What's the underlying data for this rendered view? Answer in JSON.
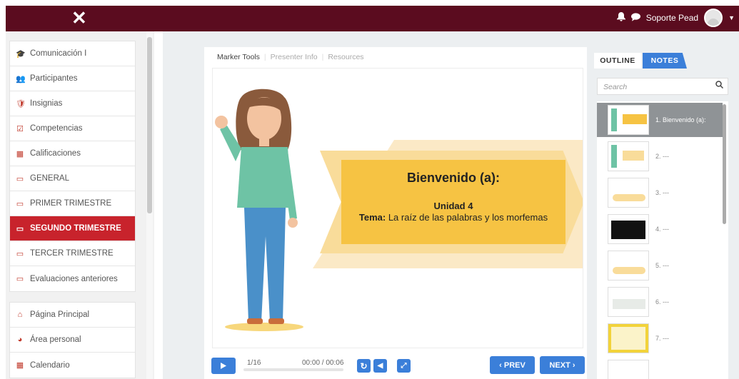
{
  "header": {
    "close_label": "✕",
    "user_name": "Soporte Pead",
    "icons": [
      "bell-icon",
      "chat-icon",
      "caret-down-icon"
    ]
  },
  "sidebar": {
    "course_items": [
      {
        "label": "Comunicación I",
        "icon": "graduation-cap-icon",
        "glyph": "🎓"
      },
      {
        "label": "Participantes",
        "icon": "users-icon",
        "glyph": "👥"
      },
      {
        "label": "Insignias",
        "icon": "shield-icon",
        "glyph": "🛡"
      },
      {
        "label": "Competencias",
        "icon": "check-square-icon",
        "glyph": "☑"
      },
      {
        "label": "Calificaciones",
        "icon": "table-icon",
        "glyph": "▦"
      },
      {
        "label": "GENERAL",
        "icon": "folder-icon",
        "glyph": "▭"
      },
      {
        "label": "PRIMER TRIMESTRE",
        "icon": "folder-icon",
        "glyph": "▭"
      },
      {
        "label": "SEGUNDO TRIMESTRE",
        "icon": "folder-icon",
        "glyph": "▭"
      },
      {
        "label": "TERCER TRIMESTRE",
        "icon": "folder-icon",
        "glyph": "▭"
      },
      {
        "label": "Evaluaciones anteriores",
        "icon": "folder-icon",
        "glyph": "▭"
      }
    ],
    "site_items": [
      {
        "label": "Página Principal",
        "icon": "home-icon",
        "glyph": "⌂"
      },
      {
        "label": "Área personal",
        "icon": "dashboard-icon",
        "glyph": "◕"
      },
      {
        "label": "Calendario",
        "icon": "calendar-icon",
        "glyph": "▦"
      }
    ]
  },
  "player": {
    "tabs": [
      "Marker Tools",
      "Presenter Info",
      "Resources"
    ],
    "slide": {
      "title": "Bienvenido (a):",
      "unit": "Unidad 4",
      "topic_label": "Tema:",
      "topic_text": "La raíz de las palabras y los morfemas"
    },
    "controls": {
      "slide_counter": "1/16",
      "time": "00:00 / 00:06",
      "prev_label": "‹ PREV",
      "next_label": "NEXT ›",
      "progress": 0
    }
  },
  "right_panel": {
    "tabs": [
      "OUTLINE",
      "NOTES"
    ],
    "search_placeholder": "Search",
    "outline": [
      {
        "label": "1. Bienvenido (a):"
      },
      {
        "label": "2. ---"
      },
      {
        "label": "3. ---"
      },
      {
        "label": "4. ---"
      },
      {
        "label": "5. ---"
      },
      {
        "label": "6. ---"
      },
      {
        "label": "7. ---"
      }
    ]
  }
}
